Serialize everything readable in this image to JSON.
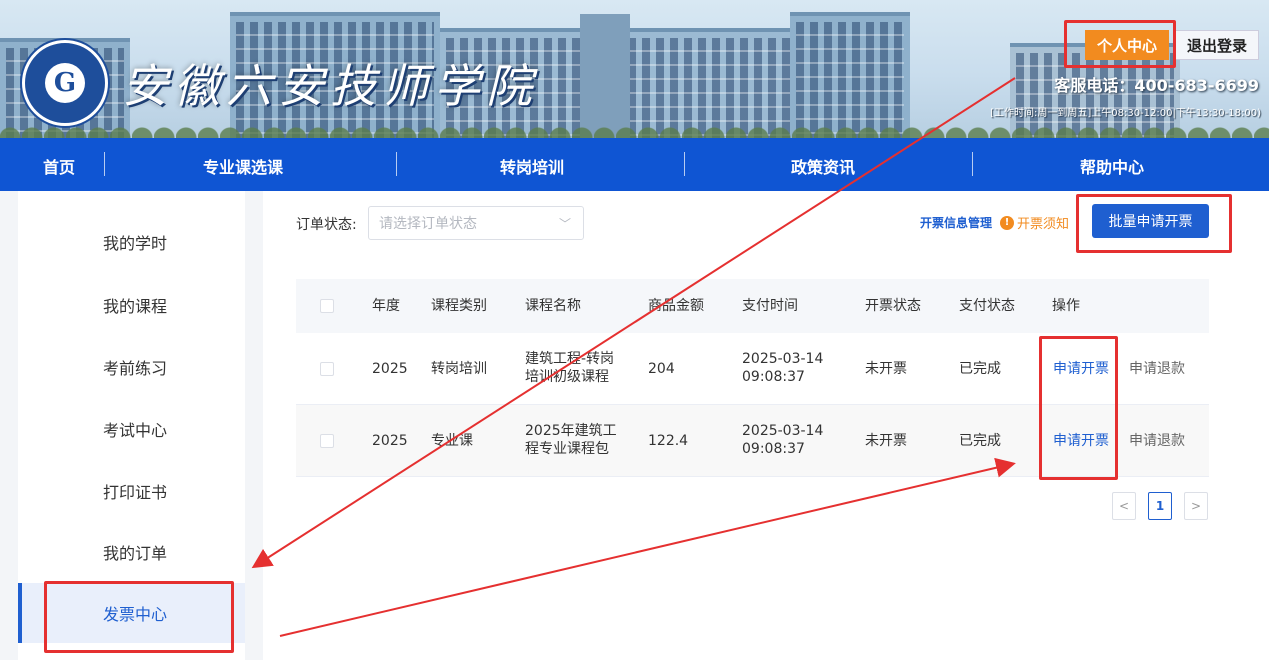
{
  "header": {
    "school_name": "安徽六安技师学院",
    "personal_center": "个人中心",
    "logout": "退出登录",
    "hotline": "客服电话：400-683-6699",
    "work_time": "[工作时间:周一到周五]上午08:30-12:00|下午13:30-18:00)"
  },
  "nav": {
    "items": [
      "首页",
      "专业课选课",
      "转岗培训",
      "政策资讯",
      "帮助中心"
    ]
  },
  "sidebar": {
    "items": [
      "我的学时",
      "我的课程",
      "考前练习",
      "考试中心",
      "打印证书",
      "我的订单",
      "发票中心"
    ],
    "active_index": 6
  },
  "filter": {
    "label": "订单状态:",
    "placeholder": "请选择订单状态"
  },
  "toolbar": {
    "invoice_mgmt": "开票信息管理",
    "notice": "开票须知",
    "batch_button": "批量申请开票"
  },
  "table": {
    "headers": [
      "年度",
      "课程类别",
      "课程名称",
      "商品金额",
      "支付时间",
      "开票状态",
      "支付状态",
      "操作"
    ],
    "rows": [
      {
        "year": "2025",
        "category": "转岗培训",
        "name_line1": "建筑工程-转岗",
        "name_line2": "培训初级课程",
        "amount": "204",
        "pay_date": "2025-03-14",
        "pay_time": "09:08:37",
        "invoice_status": "未开票",
        "pay_status": "已完成",
        "action_apply": "申请开票",
        "action_refund": "申请退款"
      },
      {
        "year": "2025",
        "category": "专业课",
        "name_line1": "2025年建筑工",
        "name_line2": "程专业课程包",
        "amount": "122.4",
        "pay_date": "2025-03-14",
        "pay_time": "09:08:37",
        "invoice_status": "未开票",
        "pay_status": "已完成",
        "action_apply": "申请开票",
        "action_refund": "申请退款"
      }
    ]
  },
  "pagination": {
    "prev": "<",
    "current": "1",
    "next": ">"
  },
  "colors": {
    "nav_blue": "#0f55d3",
    "primary_blue": "#1f5fd0",
    "orange": "#f28b1f",
    "annotation_red": "#e53030"
  }
}
